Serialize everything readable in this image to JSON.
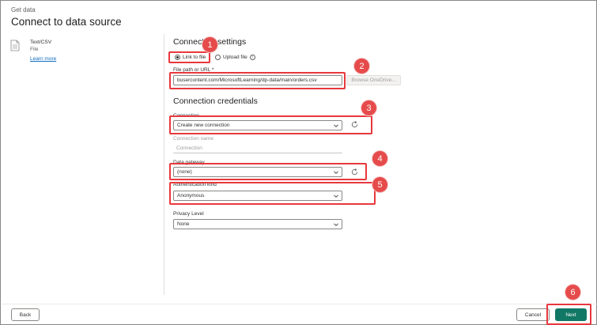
{
  "header": {
    "breadcrumb": "Get data",
    "title": "Connect to data source"
  },
  "source": {
    "name": "Text/CSV",
    "type": "File",
    "learn_more": "Learn more"
  },
  "settings": {
    "heading": "Connection settings",
    "link_option": "Link to file",
    "upload_option": "Upload file",
    "selected_option": "Link to file",
    "path_label": "File path or URL *",
    "path_value": "busercontent.com/MicrosoftLearning/dp-data/main/orders.csv",
    "browse_label": "Browse OneDrive..."
  },
  "credentials": {
    "heading": "Connection credentials",
    "connection_label": "Connection",
    "connection_value": "Create new connection",
    "connection_name_label": "Connection name",
    "connection_name_placeholder": "Connection",
    "gateway_label": "Data gateway",
    "gateway_value": "(none)",
    "auth_label": "Authentication kind",
    "auth_value": "Anonymous",
    "privacy_label": "Privacy Level",
    "privacy_value": "None"
  },
  "footer": {
    "back_label": "Back",
    "cancel_label": "Cancel",
    "next_label": "Next"
  },
  "annotations": [
    "1",
    "2",
    "3",
    "4",
    "5",
    "6"
  ],
  "colors": {
    "accent_primary": "#117865",
    "highlight": "#e8383d",
    "badge": "#e64b4b",
    "link": "#0f6cbd"
  },
  "icons": {
    "file": "file-icon",
    "info": "info-icon",
    "chevron": "chevron-down-icon",
    "refresh": "refresh-icon"
  }
}
